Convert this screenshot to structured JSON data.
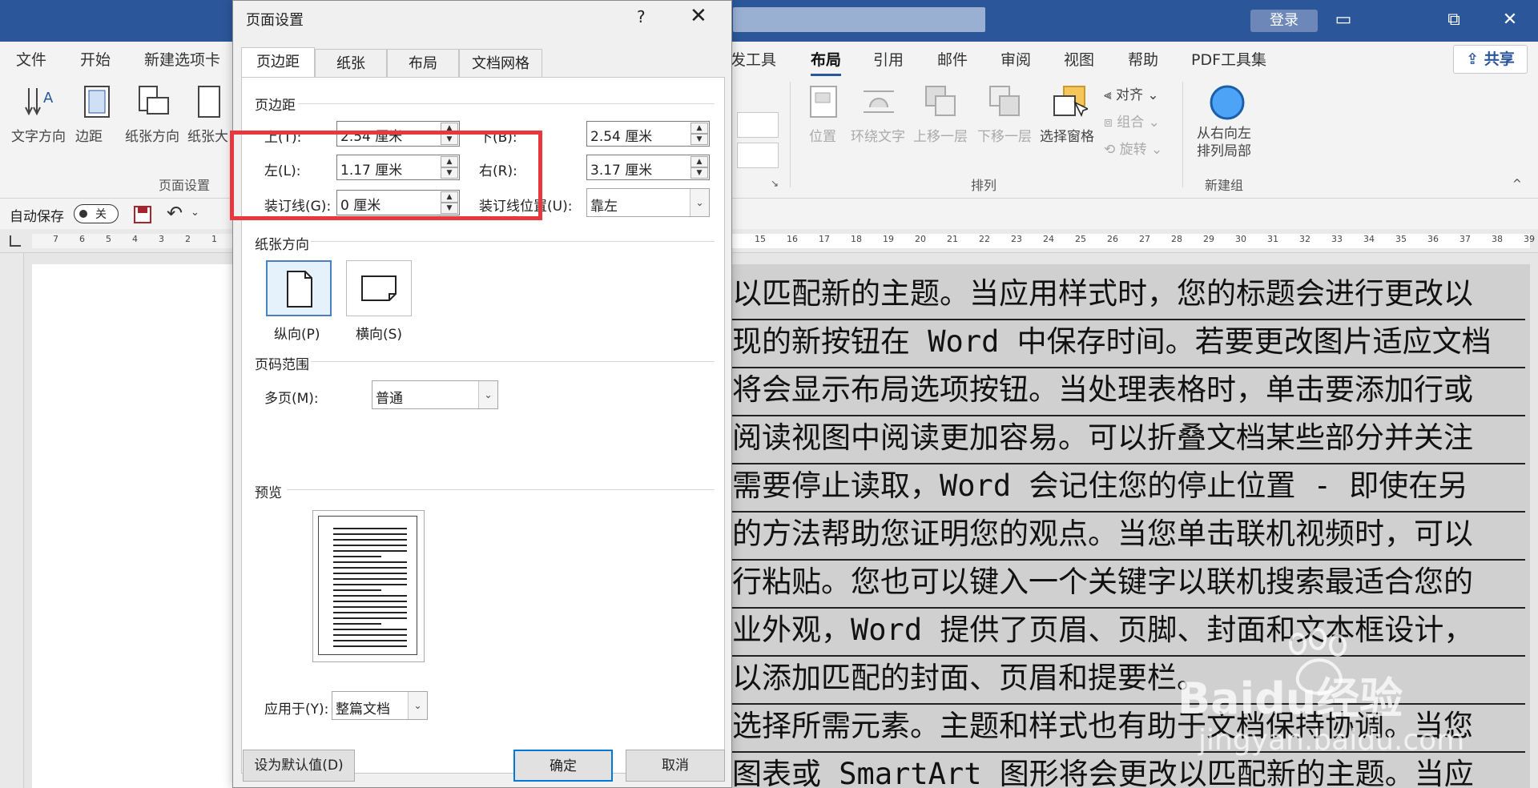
{
  "titlebar": {
    "login": "登录",
    "restore_glyph": "⧉",
    "close_glyph": "✕"
  },
  "ribbon": {
    "tabs_left": [
      "文件",
      "开始",
      "新建选项卡"
    ],
    "tabs_right": [
      "发工具",
      "布局",
      "引用",
      "邮件",
      "审阅",
      "视图",
      "帮助",
      "PDF工具集"
    ],
    "share": "共享",
    "page_setup_buttons": [
      "文字方向",
      "边距",
      "纸张方向",
      "纸张大"
    ],
    "page_setup_group": "页面设置",
    "arrange_buttons": [
      "位置",
      "环绕文字",
      "上移一层",
      "下移一层",
      "选择窗格"
    ],
    "arrange_small": [
      "对齐",
      "组合",
      "旋转"
    ],
    "arrange_group": "排列",
    "new_group_button": "从右向左\n排列局部",
    "new_group_label": "新建组"
  },
  "qat": {
    "autosave": "自动保存",
    "toggle": "关"
  },
  "ruler_left": [
    "7",
    "6",
    "5",
    "4",
    "3",
    "2",
    "1"
  ],
  "ruler_right": [
    "15",
    "16",
    "17",
    "18",
    "19",
    "20",
    "21",
    "22",
    "23",
    "24",
    "25",
    "26",
    "27",
    "28",
    "29",
    "30",
    "31",
    "32",
    "33",
    "34",
    "35",
    "36",
    "37",
    "38",
    "39"
  ],
  "document": {
    "lines": [
      "以匹配新的主题。当应用样式时，您的标题会进行更改以",
      "现的新按钮在 Word 中保存时间。若要更改图片适应文档",
      "将会显示布局选项按钮。当处理表格时，单击要添加行或",
      "阅读视图中阅读更加容易。可以折叠文档某些部分并关注",
      "需要停止读取，Word 会记住您的停止位置 - 即使在另",
      "的方法帮助您证明您的观点。当您单击联机视频时，可以",
      "行粘贴。您也可以键入一个关键字以联机搜索最适合您的",
      "业外观，Word 提供了页眉、页脚、封面和文本框设计，",
      "以添加匹配的封面、页眉和提要栏。",
      "选择所需元素。主题和样式也有助于文档保持协调。当您",
      "图表或 SmartArt 图形将会更改以匹配新的主题。当应"
    ]
  },
  "watermark": {
    "text": "Baidu经验",
    "url": "jingyan.baidu.com"
  },
  "dialog": {
    "title": "页面设置",
    "help": "?",
    "close": "✕",
    "tabs": [
      "页边距",
      "纸张",
      "布局",
      "文档网格"
    ],
    "margins_section": "页边距",
    "top_label": "上(T):",
    "top_value": "2.54 厘米",
    "bottom_label": "下(B):",
    "bottom_value": "2.54 厘米",
    "left_label": "左(L):",
    "left_value": "1.17 厘米",
    "right_label": "右(R):",
    "right_value": "3.17 厘米",
    "gutter_label": "装订线(G):",
    "gutter_value": "0 厘米",
    "gutter_pos_label": "装订线位置(U):",
    "gutter_pos_value": "靠左",
    "orientation_section": "纸张方向",
    "portrait": "纵向(P)",
    "landscape": "横向(S)",
    "pages_section": "页码范围",
    "multiple_label": "多页(M):",
    "multiple_value": "普通",
    "preview_section": "预览",
    "apply_label": "应用于(Y):",
    "apply_value": "整篇文档",
    "default_btn": "设为默认值(D)",
    "ok_btn": "确定",
    "cancel_btn": "取消"
  },
  "colors": {
    "titlebar": "#2b579a",
    "highlight_box": "#e8383d",
    "ok_border": "#0078d7"
  }
}
